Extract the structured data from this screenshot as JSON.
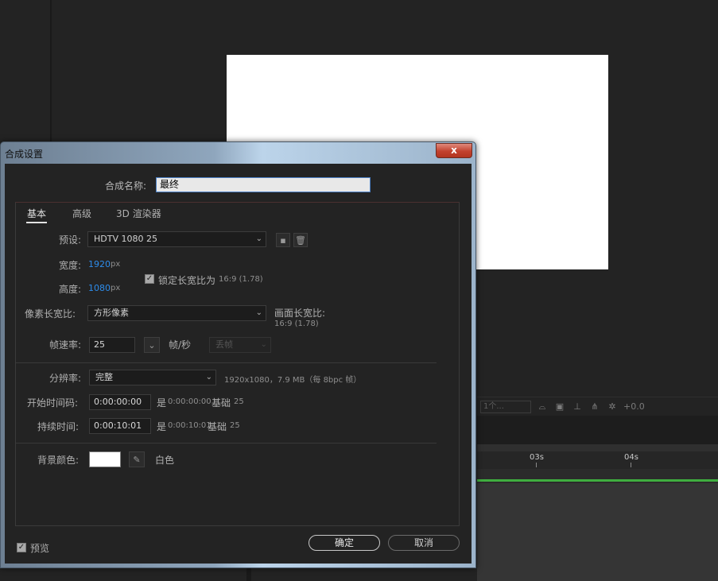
{
  "background": {
    "toolbar": {
      "select_label": "1个...",
      "offset_value": "+0.0"
    },
    "ruler": {
      "ticks": [
        "03s",
        "04s"
      ]
    }
  },
  "dialog": {
    "title": "合成设置",
    "close_glyph": "x",
    "name_label": "合成名称:",
    "name_value": "最终",
    "tabs": [
      {
        "label": "基本",
        "active": true
      },
      {
        "label": "高级",
        "active": false
      },
      {
        "label": "3D 渲染器",
        "active": false
      }
    ],
    "preset": {
      "label": "预设:",
      "value": "HDTV 1080 25"
    },
    "width": {
      "label": "宽度:",
      "value": "1920",
      "unit": "px"
    },
    "height": {
      "label": "高度:",
      "value": "1080",
      "unit": "px"
    },
    "lock_aspect": {
      "checked": true,
      "label": "锁定长宽比为",
      "ratio": "16:9 (1.78)"
    },
    "pixel_aspect": {
      "label": "像素长宽比:",
      "value": "方形像素",
      "frame_aspect_label": "画面长宽比:",
      "frame_aspect_value": "16:9 (1.78)"
    },
    "frame_rate": {
      "label": "帧速率:",
      "value": "25",
      "unit": "帧/秒",
      "drop_frame": "丢帧"
    },
    "resolution": {
      "label": "分辨率:",
      "value": "完整",
      "info": "1920x1080，7.9 MB（每 8bpc 帧）"
    },
    "start_timecode": {
      "label": "开始时间码:",
      "value": "0:00:00:00",
      "is_prefix": "是",
      "is_value": "0:00:00:00",
      "base_label": "基础",
      "base_value": "25"
    },
    "duration": {
      "label": "持续时间:",
      "value": "0:00:10:01",
      "is_prefix": "是",
      "is_value": "0:00:10:01",
      "base_label": "基础",
      "base_value": "25"
    },
    "bg_color": {
      "label": "背景颜色:",
      "color": "#ffffff",
      "name": "白色"
    },
    "preview": {
      "checked": true,
      "label": "预览"
    },
    "ok_label": "确定",
    "cancel_label": "取消"
  }
}
